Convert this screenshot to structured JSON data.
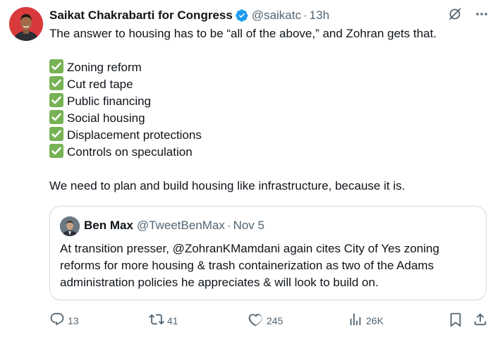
{
  "author": {
    "name": "Saikat Chakrabarti for Congress",
    "handle": "@saikatc",
    "separator": "·",
    "time": "13h"
  },
  "tweet": {
    "intro": "The answer to housing has to be “all of the above,” and Zohran gets that.",
    "checklist": [
      "Zoning reform",
      "Cut red tape",
      "Public financing",
      "Social housing",
      "Displacement protections",
      "Controls on speculation"
    ],
    "closing": "We need to plan and build housing like infrastructure, because it is."
  },
  "quote": {
    "name": "Ben Max",
    "handle": "@TweetBenMax",
    "separator": "·",
    "time": "Nov 5",
    "text": "At transition presser, @ZohranKMamdani again cites City of Yes zoning reforms for more housing & trash containerization as two of the Adams administration policies he appreciates & will look to build on."
  },
  "actions": {
    "replies": "13",
    "reposts": "41",
    "likes": "245",
    "views": "26K"
  },
  "icons": {
    "verified": "verified-badge-icon",
    "grok": "grok-icon",
    "more": "more-icon",
    "check": "check-mark-icon",
    "reply": "reply-icon",
    "repost": "repost-icon",
    "like": "heart-icon",
    "views": "views-icon",
    "bookmark": "bookmark-icon",
    "share": "share-icon"
  },
  "colors": {
    "text": "#0f1419",
    "muted": "#536471",
    "verified": "#1d9bf0",
    "check": "#77b255",
    "border": "#cfd9de",
    "avatar_bg": "#d8393b"
  }
}
